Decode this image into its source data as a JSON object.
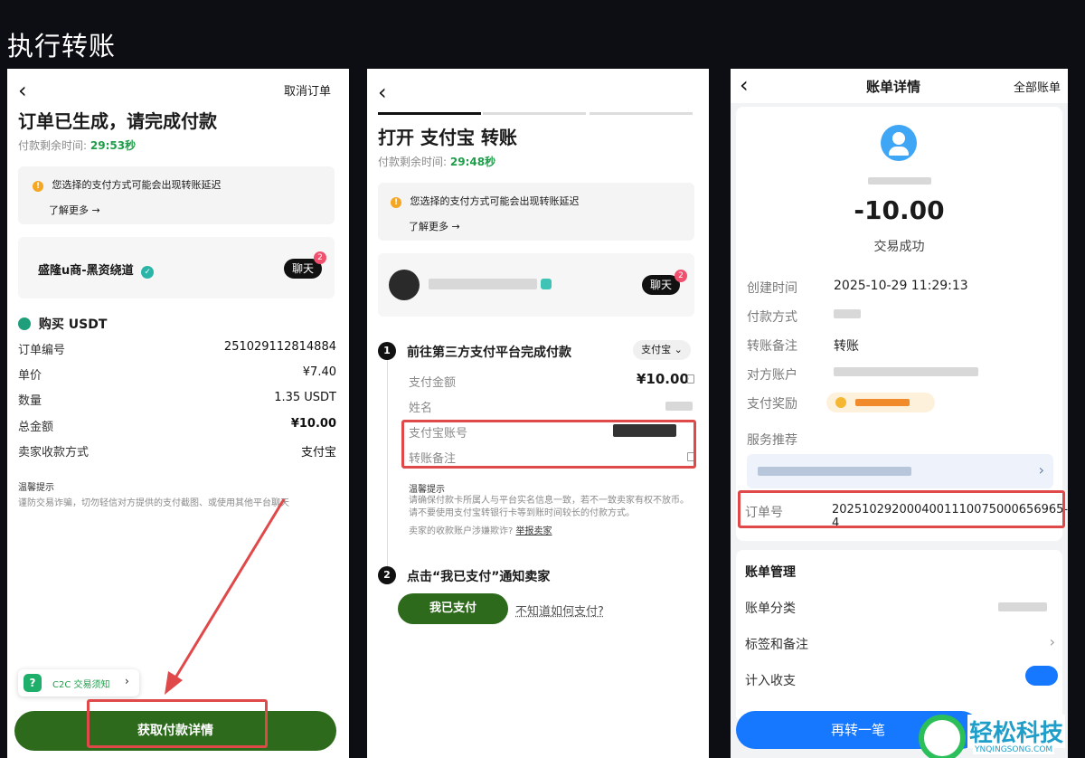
{
  "title": "执行转账",
  "p1": {
    "cancel": "取消订单",
    "heading": "订单已生成，请完成付款",
    "timer_label": "付款剩余时间:",
    "timer": "29:53秒",
    "warning": "您选择的支付方式可能会出现转账延迟",
    "learn_more": "了解更多 →",
    "merchant": "盛隆u商-黑资绕道",
    "chat": "聊天",
    "chat_badge": "2",
    "buy": "购买 USDT",
    "rows": [
      {
        "k": "订单编号",
        "v": "251029112814884"
      },
      {
        "k": "单价",
        "v": "¥7.40"
      },
      {
        "k": "数量",
        "v": "1.35 USDT"
      },
      {
        "k": "总金额",
        "v": "¥10.00"
      },
      {
        "k": "卖家收款方式",
        "v": "支付宝"
      }
    ],
    "tips_title": "温馨提示",
    "tips": "谨防交易诈骗，切勿轻信对方提供的支付截图、或使用其他平台聊天",
    "notice": "C2C 交易须知",
    "notice_arrow": "›",
    "primary": "获取付款详情"
  },
  "p2": {
    "heading": "打开 支付宝 转账",
    "timer_label": "付款剩余时间:",
    "timer": "29:48秒",
    "warning": "您选择的支付方式可能会出现转账延迟",
    "learn_more": "了解更多 →",
    "chat": "聊天",
    "chat_badge": "2",
    "step1_num": "1",
    "step1": "前往第三方支付平台完成付款",
    "method": "支付宝",
    "amount_label": "支付金额",
    "amount": "¥10.00",
    "name_label": "姓名",
    "account_label": "支付宝账号",
    "remark_label": "转账备注",
    "tips_title": "温馨提示",
    "tips": "请确保付款卡所属人与平台实名信息一致，若不一致卖家有权不放币。请不要使用支付宝转银行卡等到账时间较长的付款方式。",
    "tips2": "卖家的收款账户涉嫌欺诈?",
    "report": "举报卖家",
    "step2_num": "2",
    "step2": "点击“我已支付”通知卖家",
    "paid_btn": "我已支付",
    "how": "不知道如何支付?"
  },
  "p3": {
    "title": "账单详情",
    "all": "全部账单",
    "amount": "-10.00",
    "status": "交易成功",
    "rows": [
      {
        "k": "创建时间",
        "v": "2025-10-29 11:29:13"
      },
      {
        "k": "付款方式",
        "v": ""
      },
      {
        "k": "转账备注",
        "v": "转账"
      },
      {
        "k": "对方账户",
        "v": ""
      },
      {
        "k": "支付奖励",
        "v": ""
      },
      {
        "k": "服务推荐",
        "v": ""
      }
    ],
    "order_label": "订单号",
    "order_no": "2025102920004001110075000656965­4",
    "manage": "账单管理",
    "category": "账单分类",
    "tags": "标签和备注",
    "count": "计入收支",
    "again": "再转一笔",
    "watermark": "轻松科技",
    "watermark_sub": "YNQINGSONG.COM"
  },
  "colors": {
    "green": "#1e9e4a",
    "button": "#2d6a1c",
    "highlight": "#e0494a",
    "blue": "#1677ff"
  }
}
